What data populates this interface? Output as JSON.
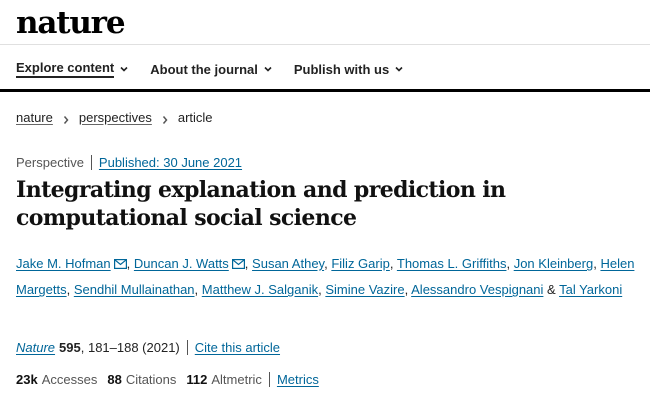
{
  "header": {
    "logo": "nature"
  },
  "nav": {
    "items": [
      {
        "label": "Explore content"
      },
      {
        "label": "About the journal"
      },
      {
        "label": "Publish with us"
      }
    ]
  },
  "breadcrumb": {
    "items": [
      "nature",
      "perspectives"
    ],
    "current": "article"
  },
  "article": {
    "type": "Perspective",
    "published": "Published: 30 June 2021",
    "title": "Integrating explanation and prediction in computational social science",
    "authors": [
      "Jake M. Hofman",
      "Duncan J. Watts",
      "Susan Athey",
      "Filiz Garip",
      "Thomas L. Griffiths",
      "Jon Kleinberg",
      "Helen Margetts",
      "Sendhil Mullainathan",
      "Matthew J. Salganik",
      "Simine Vazire",
      "Alessandro Vespignani",
      "Tal Yarkoni"
    ],
    "author_separator": ",",
    "author_and": "&",
    "corresponding_icon": "envelope-icon"
  },
  "citation": {
    "journal": "Nature",
    "volume": "595",
    "pages": ", 181–188 (2021)",
    "cite_link": "Cite this article"
  },
  "metrics": {
    "accesses_value": "23k",
    "accesses_label": "Accesses",
    "citations_value": "88",
    "citations_label": "Citations",
    "altmetric_value": "112",
    "altmetric_label": "Altmetric",
    "metrics_link": "Metrics"
  },
  "colors": {
    "link": "#006699",
    "text": "#222222",
    "muted": "#555555"
  }
}
